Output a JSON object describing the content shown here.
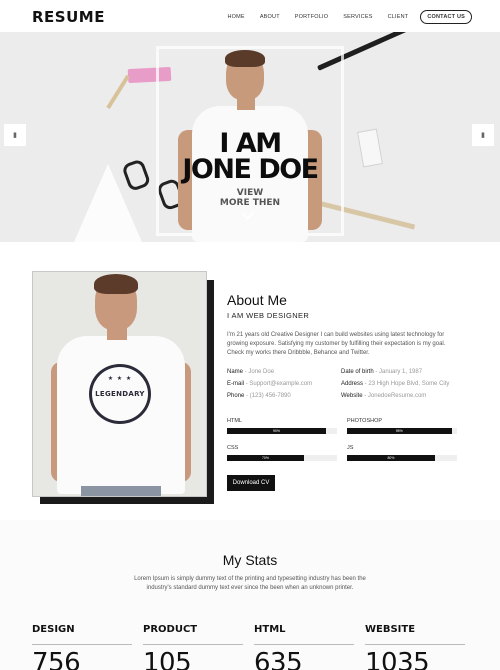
{
  "nav": {
    "logo": "RESUME",
    "items": [
      "HOME",
      "ABOUT",
      "PORTFOLIO",
      "SERVICES",
      "CLIENT"
    ],
    "contact": "CONTACT US"
  },
  "hero": {
    "line1": "I AM",
    "line2": "JONE DOE",
    "view1": "VIEW",
    "view2": "MORE THEN",
    "prev_icon": "slide-prev-icon",
    "next_icon": "slide-next-icon"
  },
  "portrait": {
    "shirt_text": "LEGENDARY"
  },
  "about": {
    "title": "About Me",
    "subtitle": "I AM WEB DESIGNER",
    "description": "I'm 21 years old Creative Designer I can build websites using latest technology for growing exposure. Satisfying my customer by fulfilling their expectation is my goal. Check my works there Dribbble, Behance and Twitter.",
    "name_label": "Name",
    "name_value": "Jone Doe",
    "email_label": "E-mail",
    "email_value": "Support@example.com",
    "phone_label": "Phone",
    "phone_value": "(123) 456-7890",
    "dob_label": "Date of birth",
    "dob_value": "January 1, 1987",
    "address_label": "Address",
    "address_value": "23 High Hope Blvd, Some City",
    "website_label": "Website",
    "website_value": "JonedoeResume.com",
    "download": "Download CV"
  },
  "skills": [
    {
      "name": "HTML",
      "percent": 90,
      "label": "90%"
    },
    {
      "name": "PHOTOSHOP",
      "percent": 95,
      "label": "95%"
    },
    {
      "name": "CSS",
      "percent": 70,
      "label": "70%"
    },
    {
      "name": "JS",
      "percent": 80,
      "label": "80%"
    }
  ],
  "stats": {
    "title": "My Stats",
    "description": "Lorem Ipsum is simply dummy text of the printing and typesetting industry has been the industry's standard dummy text ever since the been when an unknown printer.",
    "items": [
      {
        "name": "DESIGN",
        "value": "756"
      },
      {
        "name": "PRODUCT",
        "value": "105"
      },
      {
        "name": "HTML",
        "value": "635"
      },
      {
        "name": "WEBSITE",
        "value": "1035"
      }
    ]
  }
}
